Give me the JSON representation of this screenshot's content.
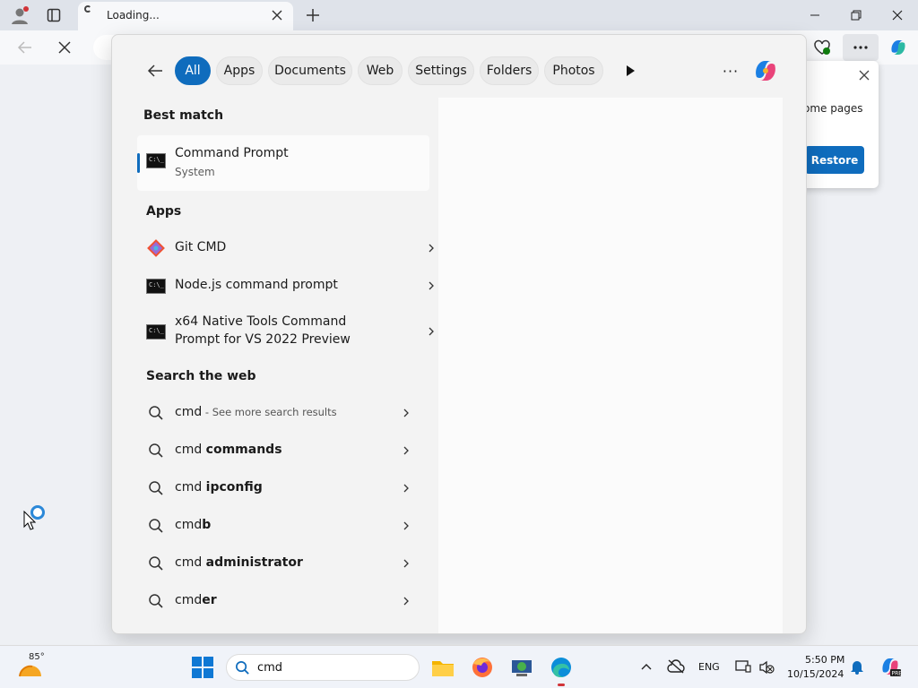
{
  "browser": {
    "tab_title": "Loading...",
    "popup": {
      "text": "ome pages",
      "restore_label": "Restore"
    }
  },
  "search": {
    "filters": [
      "All",
      "Apps",
      "Documents",
      "Web",
      "Settings",
      "Folders",
      "Photos"
    ],
    "more_label": "···",
    "best_match_title": "Best match",
    "best_match": {
      "name": "Command Prompt",
      "type": "System"
    },
    "apps_title": "Apps",
    "apps": [
      {
        "name": "Git CMD"
      },
      {
        "name": "Node.js command prompt"
      },
      {
        "name_line1": "x64 Native Tools Command",
        "name_line2": "Prompt for VS 2022 Preview"
      }
    ],
    "web_title": "Search the web",
    "web": [
      {
        "query": "cmd",
        "bold": "",
        "hint": " - See more search results"
      },
      {
        "query": "cmd ",
        "bold": "commands",
        "hint": ""
      },
      {
        "query": "cmd ",
        "bold": "ipconfig",
        "hint": ""
      },
      {
        "query": "cmd",
        "bold": "b",
        "hint": ""
      },
      {
        "query": "cmd ",
        "bold": "administrator",
        "hint": ""
      },
      {
        "query": "cmd",
        "bold": "er",
        "hint": ""
      }
    ]
  },
  "taskbar": {
    "temperature": "85°",
    "search_text": "cmd",
    "language": "ENG",
    "time": "5:50 PM",
    "date": "10/15/2024"
  },
  "colors": {
    "accent": "#0f6cbd"
  }
}
